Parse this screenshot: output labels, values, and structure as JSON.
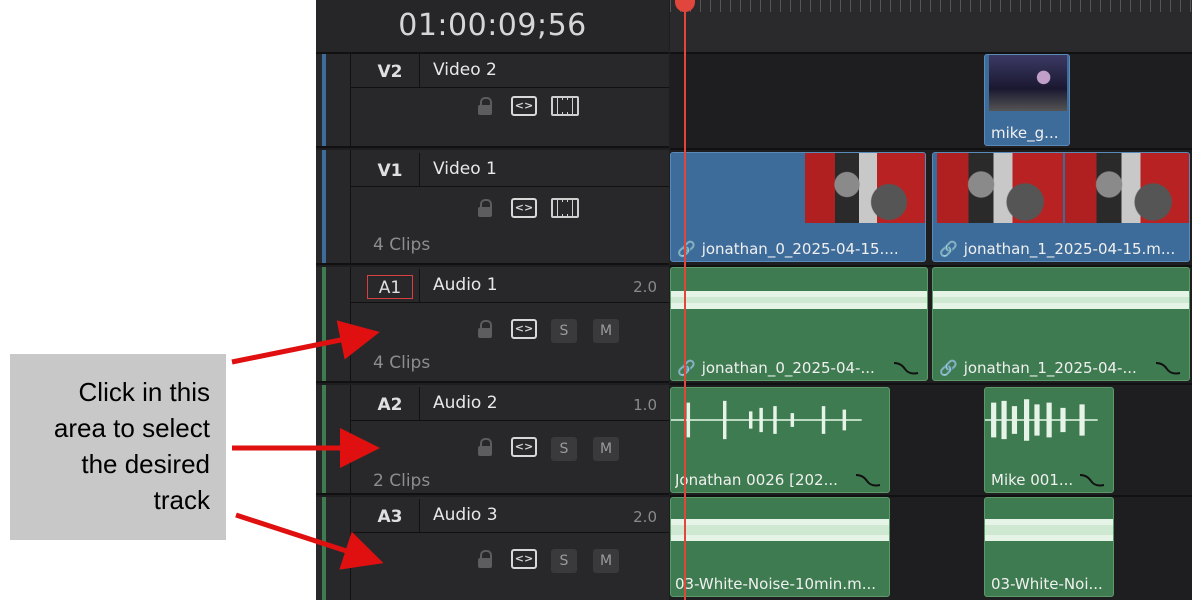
{
  "timecode": "01:00:09;56",
  "tracks": [
    {
      "id": "V2",
      "name": "Video 2",
      "channel": "",
      "clips": "",
      "kind": "video",
      "color": "#3e6c9a"
    },
    {
      "id": "V1",
      "name": "Video 1",
      "channel": "",
      "clips": "4 Clips",
      "kind": "video",
      "color": "#3e6c9a"
    },
    {
      "id": "A1",
      "name": "Audio 1",
      "channel": "2.0",
      "clips": "4 Clips",
      "kind": "audio",
      "color": "#3f7b50",
      "selected": true
    },
    {
      "id": "A2",
      "name": "Audio 2",
      "channel": "1.0",
      "clips": "2 Clips",
      "kind": "audio",
      "color": "#3f7b50"
    },
    {
      "id": "A3",
      "name": "Audio 3",
      "channel": "2.0",
      "clips": "",
      "kind": "audio",
      "color": "#3f7b50"
    }
  ],
  "buttons": {
    "solo": "S",
    "mute": "M",
    "sync": "<>"
  },
  "timeline_clips": {
    "v2_clip": "mike_g...",
    "v1_clip_a": "jonathan_0_2025-04-15....",
    "v1_clip_b": "jonathan_1_2025-04-15.m...",
    "a1_clip_a": "jonathan_0_2025-04-...",
    "a1_clip_b": "jonathan_1_2025-04-...",
    "a2_clip_a": "Jonathan 0026 [202...",
    "a2_clip_b": "Mike 001...",
    "a3_clip_a": "03-White-Noise-10min.m...",
    "a3_clip_b": "03-White-Noi..."
  },
  "callout": {
    "lines": [
      "Click in this",
      "area to select",
      "the desired",
      "track"
    ]
  },
  "colors": {
    "playhead": "#e0463c",
    "arrow": "#e01010"
  }
}
